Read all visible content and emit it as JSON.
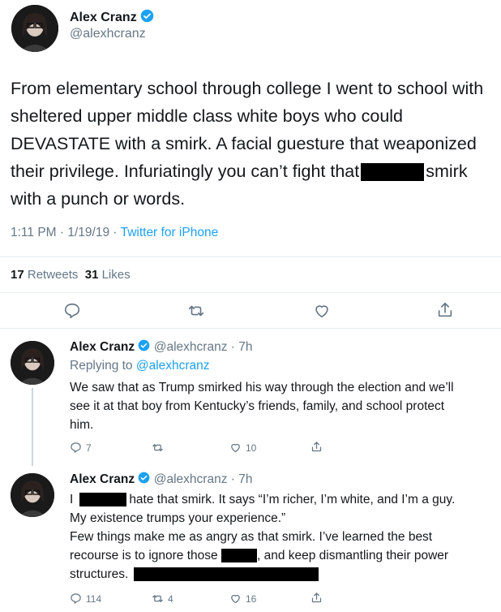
{
  "main_tweet": {
    "name": "Alex Cranz",
    "handle": "@alexhcranz",
    "text_line1": "From elementary school through college I went to school with",
    "text_line2": "sheltered upper middle class white boys who could",
    "text_line3": "DEVASTATE with a smirk. A facial guesture that weaponized",
    "text_line4_a": "their privilege. Infuriatingly you can’t fight that",
    "text_line4_b": "smirk",
    "text_line5": "with a punch or words.",
    "time": "1:11 PM",
    "date": "1/19/19",
    "source": "Twitter for iPhone",
    "retweets_count": "17",
    "retweets_label": "Retweets",
    "likes_count": "31",
    "likes_label": "Likes"
  },
  "replies": [
    {
      "name": "Alex Cranz",
      "handle": "@alexhcranz",
      "age": "7h",
      "replying_label": "Replying to",
      "replying_handle": "@alexhcranz",
      "line1": "We saw that as Trump smirked his way through the election and we’ll",
      "line2": "see it at that boy from Kentucky’s friends, family, and school protect",
      "line3": "him.",
      "replies_count": "7",
      "retweets_count": "",
      "likes_count": "10"
    },
    {
      "name": "Alex Cranz",
      "handle": "@alexhcranz",
      "age": "7h",
      "line1_a": "I",
      "line1_b": "hate that smirk. It says “I’m richer, I’m white, and I’m a guy.",
      "line2": "My existence trumps your experience.”",
      "line3": "Few things make me as angry as that smirk. I’ve learned the best",
      "line4_a": "recourse is to ignore those",
      "line4_b": ", and keep dismantling their power",
      "line5": "structures.",
      "replies_count": "114",
      "retweets_count": "4",
      "likes_count": "16"
    }
  ],
  "icons": {
    "verified": "verified-badge-icon",
    "reply": "reply-icon",
    "retweet": "retweet-icon",
    "like": "heart-icon",
    "share": "share-icon"
  },
  "colors": {
    "accent": "#1da1f2",
    "text": "#14171a",
    "secondary": "#657786",
    "divider": "#e6ecf0"
  }
}
